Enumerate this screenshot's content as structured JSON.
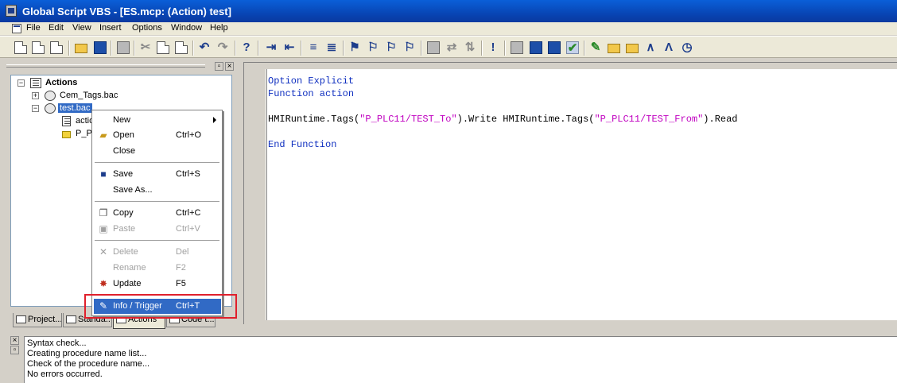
{
  "window": {
    "title": "Global Script VBS - [ES.mcp: (Action) test]"
  },
  "menubar": {
    "items": [
      "File",
      "Edit",
      "View",
      "Insert",
      "Options",
      "Window",
      "Help"
    ]
  },
  "toolbar": {
    "icons": [
      "new-icon",
      "new-project-icon",
      "new-action-icon",
      "open-icon",
      "save-icon",
      "print-icon",
      "cut-icon",
      "copy-icon",
      "paste-icon",
      "undo-icon",
      "redo-icon",
      "help-icon",
      "indent-icon",
      "outdent-icon",
      "comment-icon",
      "uncomment-icon",
      "bookmark-icon",
      "next-bookmark-icon",
      "prev-bookmark-icon",
      "clear-bookmarks-icon",
      "syntax-check-icon",
      "replace-icon",
      "goto-icon",
      "info-icon",
      "tag-icon",
      "database-icon",
      "save-all-icon",
      "compile-icon",
      "edit-icon",
      "folder-icon",
      "folder-add-icon",
      "dynamic-icon",
      "trigger-icon",
      "timer-icon"
    ]
  },
  "panel": {
    "tree": {
      "root": "Actions",
      "items": [
        "Cem_Tags.bac",
        "test.bac",
        "actio",
        "P_PL"
      ]
    },
    "tabs": [
      "Project...",
      "Standa...",
      "Actions",
      "Code t..."
    ]
  },
  "editor": {
    "lines": {
      "l1": "Option Explicit",
      "l2": "Function action",
      "l3_a": "HMIRuntime.Tags(",
      "l3_b": "\"P_PLC11/TEST_To\"",
      "l3_c": ").Write HMIRuntime.Tags(",
      "l3_d": "\"P_PLC11/TEST_From\"",
      "l3_e": ").Read",
      "l4": "End Function"
    }
  },
  "context_menu": {
    "items": [
      {
        "label": "New",
        "shortcut": ""
      },
      {
        "label": "Open",
        "shortcut": "Ctrl+O"
      },
      {
        "label": "Close",
        "shortcut": ""
      },
      {
        "label": "Save",
        "shortcut": "Ctrl+S"
      },
      {
        "label": "Save As...",
        "shortcut": ""
      },
      {
        "label": "Copy",
        "shortcut": "Ctrl+C"
      },
      {
        "label": "Paste",
        "shortcut": "Ctrl+V"
      },
      {
        "label": "Delete",
        "shortcut": "Del"
      },
      {
        "label": "Rename",
        "shortcut": "F2"
      },
      {
        "label": "Update",
        "shortcut": "F5"
      },
      {
        "label": "Info / Trigger",
        "shortcut": "Ctrl+T"
      }
    ],
    "highlight_color": "#316ac5",
    "annotation_color": "#e0202c"
  },
  "output": {
    "lines": [
      "Syntax check...",
      "Creating procedure name list...",
      "Check of the procedure name...",
      "No errors occurred."
    ]
  },
  "colors": {
    "keyword": "#1030c0",
    "string": "#c000c0",
    "titlebar": "#0a5fd8"
  }
}
